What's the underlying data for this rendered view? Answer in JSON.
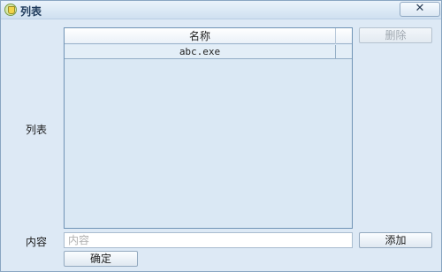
{
  "window": {
    "title": "列表",
    "close_glyph": "✕"
  },
  "form": {
    "list_label": "列表",
    "content_label": "内容",
    "content_placeholder": "内容",
    "content_value": ""
  },
  "listview": {
    "columns": [
      "名称"
    ],
    "rows": [
      "abc.exe"
    ]
  },
  "buttons": {
    "delete": "删除",
    "add": "添加",
    "confirm": "确定"
  }
}
